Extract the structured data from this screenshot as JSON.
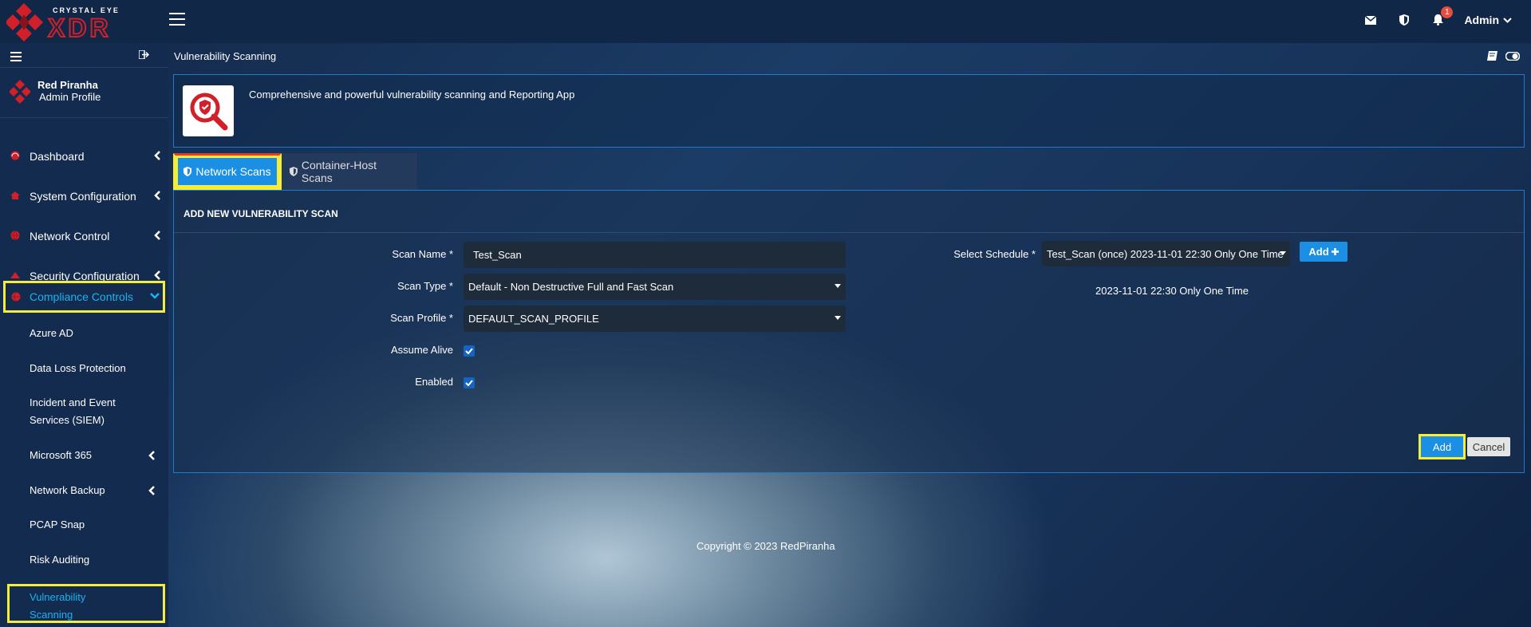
{
  "brand": {
    "line1": "CRYSTAL EYE",
    "line2": "XDR"
  },
  "topbar": {
    "notification_count": "1",
    "user": "Admin"
  },
  "sidebar": {
    "profile_name": "Red Piranha",
    "profile_role": "Admin Profile",
    "items": [
      {
        "label": "Dashboard"
      },
      {
        "label": "System Configuration"
      },
      {
        "label": "Network Control"
      },
      {
        "label": "Security Configuration"
      },
      {
        "label": "Compliance Controls"
      }
    ],
    "subitems": [
      {
        "label": "Azure AD"
      },
      {
        "label": "Data Loss Protection"
      },
      {
        "label": "Incident and Event Services (SIEM)"
      },
      {
        "label": "Microsoft 365"
      },
      {
        "label": "Network Backup"
      },
      {
        "label": "PCAP Snap"
      },
      {
        "label": "Risk Auditing"
      },
      {
        "label": "Vulnerability Scanning"
      }
    ]
  },
  "page": {
    "title": "Vulnerability Scanning",
    "app_description": "Comprehensive and powerful vulnerability scanning and Reporting App"
  },
  "tabs": [
    {
      "label": "Network Scans"
    },
    {
      "label": "Container-Host Scans"
    }
  ],
  "form": {
    "header": "ADD NEW VULNERABILITY SCAN",
    "scan_name_label": "Scan Name *",
    "scan_name_value": "Test_Scan",
    "scan_type_label": "Scan Type *",
    "scan_type_value": "Default - Non Destructive Full and Fast Scan",
    "scan_profile_label": "Scan Profile *",
    "scan_profile_value": "DEFAULT_SCAN_PROFILE",
    "assume_alive_label": "Assume Alive",
    "enabled_label": "Enabled",
    "schedule_label": "Select Schedule *",
    "schedule_value": "Test_Scan (once) 2023-11-01 22:30 Only One Time",
    "schedule_add_label": "Add",
    "schedule_info": "2023-11-01 22:30 Only One Time",
    "add_label": "Add",
    "cancel_label": "Cancel"
  },
  "footer": {
    "copyright": "Copyright © 2023 RedPiranha"
  },
  "colors": {
    "accent": "#1a8fe3",
    "highlight": "#f4ed3a",
    "brand_red": "#d0202a",
    "active_text": "#1ab3f2"
  }
}
